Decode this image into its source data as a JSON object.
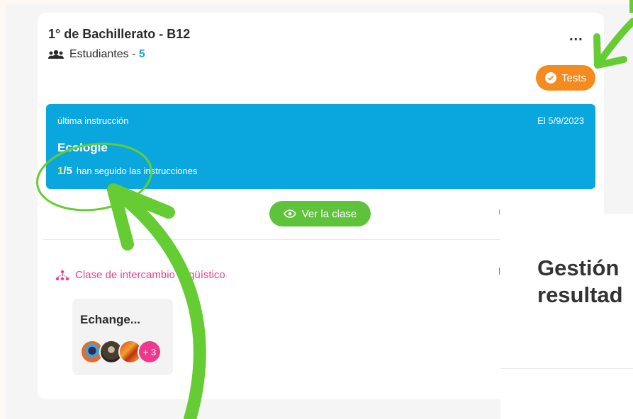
{
  "class_card": {
    "title": "1° de Bachillerato - B12",
    "students_label": "Estudiantes - ",
    "students_count": "5",
    "menu_label": "...",
    "tests_label": "Tests"
  },
  "last_instruction": {
    "label": "última instrucción",
    "date": "El 5/9/2023",
    "topic": "Ecologie",
    "done": "1",
    "total": "/5",
    "progress_text": "han seguido las instrucciones"
  },
  "view_class_label": "Ver la clase",
  "exchange": {
    "label": "Clase de intercambio lingüístico",
    "card_name": "Echange...",
    "more_count": "+ 3"
  },
  "right_panel": {
    "heading_line1": "Gestión",
    "heading_line2": "resultad"
  },
  "colors": {
    "accent_blue": "#0aa7df",
    "tests_orange": "#f58a1f",
    "view_green": "#5ec33a",
    "exchange_pink": "#ea3f92",
    "annotation_green": "#66cc33"
  },
  "icons": [
    "users-icon",
    "more-dots-icon",
    "verified-check-icon",
    "eye-icon",
    "network-icon"
  ]
}
